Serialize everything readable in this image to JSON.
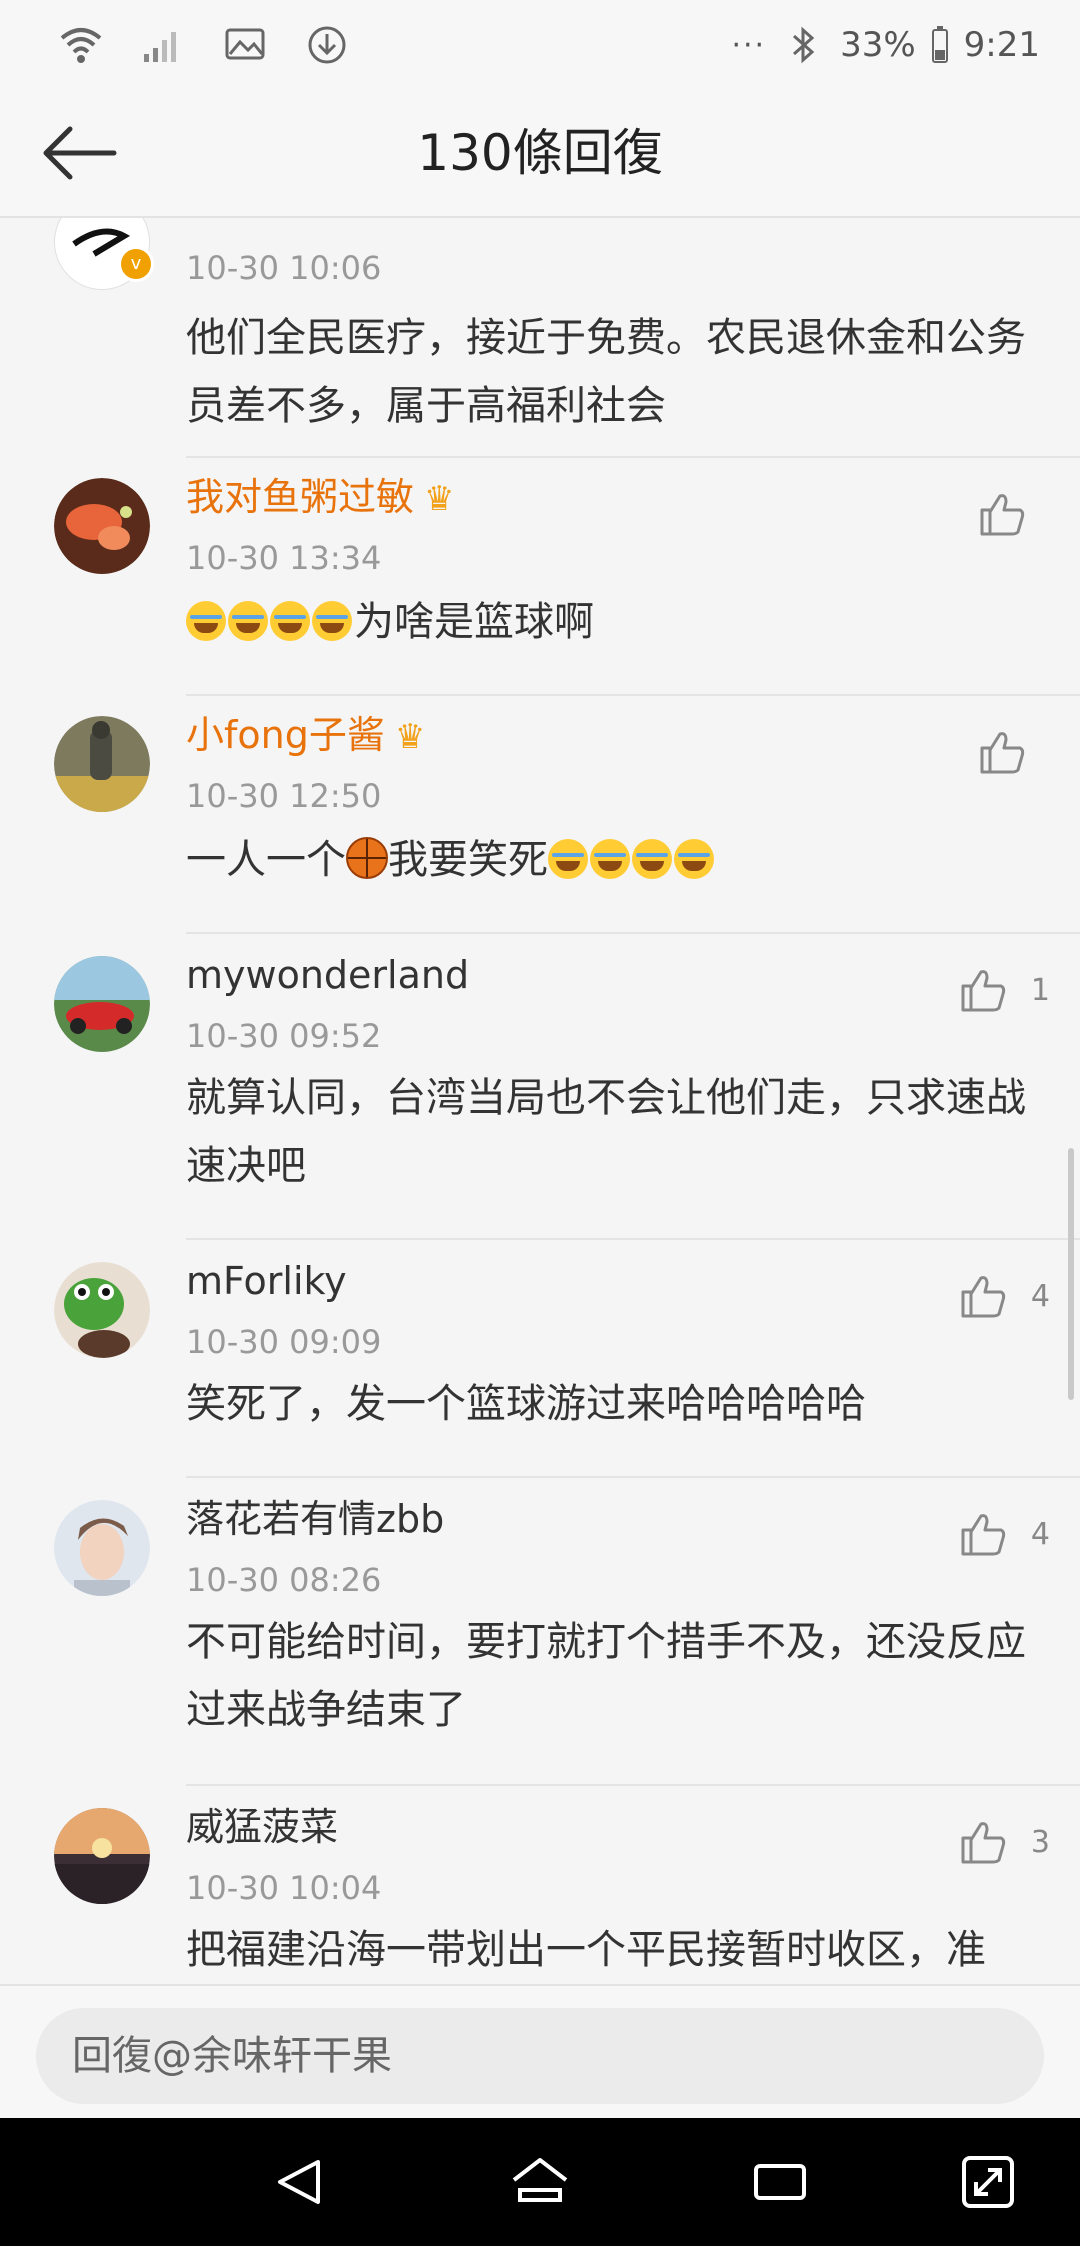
{
  "status_bar": {
    "battery_text": "33%",
    "time": "9:21",
    "left_icons": [
      "wifi-icon",
      "signal-icon",
      "image-icon",
      "download-icon"
    ],
    "right_icons": [
      "more-dots-icon",
      "bluetooth-icon",
      "battery-icon"
    ]
  },
  "header": {
    "title": "130條回復",
    "back_icon": "back-arrow-icon"
  },
  "colors": {
    "vip_name": "#e8730c",
    "accent_badge": "#f0a100",
    "background": "#f5f5f5"
  },
  "comments": [
    {
      "username": "",
      "time": "10-30 10:06",
      "text": "他们全民医疗，接近于免费。农民退休金和公务员差不多，属于高福利社会",
      "likes": "",
      "verified": true
    },
    {
      "username": "我对鱼粥过敏",
      "vip": true,
      "time": "10-30 13:34",
      "text_suffix": "为啥是篮球啊",
      "emoji_prefix_count": 4,
      "likes": ""
    },
    {
      "username": "小fong子酱",
      "vip": true,
      "time": "10-30 12:50",
      "text_part1": "一人一个",
      "text_part2": "我要笑死",
      "emoji_suffix_count": 4,
      "likes": ""
    },
    {
      "username": "mywonderland",
      "time": "10-30 09:52",
      "text": "就算认同，台湾当局也不会让他们走，只求速战速决吧",
      "likes": "1"
    },
    {
      "username": "mForliky",
      "time": "10-30 09:09",
      "text": "笑死了，发一个篮球游过来哈哈哈哈哈",
      "likes": "4"
    },
    {
      "username": "落花若有情zbb",
      "time": "10-30 08:26",
      "text": "不可能给时间，要打就打个措手不及，还没反应过来战争结束了",
      "likes": "4"
    },
    {
      "username": "威猛菠菜",
      "time": "10-30 10:04",
      "text": "把福建沿海一带划出一个平民接暂时收区，准",
      "likes": "3"
    }
  ],
  "reply": {
    "placeholder": "回復@余味轩干果"
  },
  "system_nav": {
    "buttons": [
      "back-triangle-icon",
      "home-icon",
      "recents-icon",
      "expand-icon"
    ]
  }
}
